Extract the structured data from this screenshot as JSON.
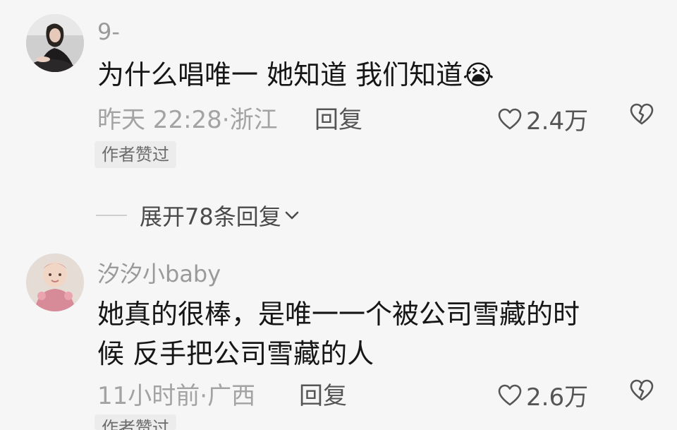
{
  "comments": [
    {
      "username": "9-",
      "text": "为什么唱唯一 她知道 我们知道",
      "emoji": "😭",
      "time_location": "昨天 22:28·浙江",
      "reply_label": "回复",
      "likes": "2.4万",
      "badge": "作者赞过",
      "expand_replies": "展开78条回复"
    },
    {
      "username": "汐汐小baby",
      "text_line1": "她真的很棒，是唯一一个被公司雪藏的时",
      "text_line2": "候 反手把公司雪藏的人",
      "time_location": "11小时前·广西",
      "reply_label": "回复",
      "likes": "2.6万",
      "badge": "作者赞过"
    }
  ],
  "colors": {
    "background": "#f6f6f6",
    "text_primary": "#161616",
    "text_secondary": "#a3a3a3",
    "badge_bg": "#ececec"
  }
}
